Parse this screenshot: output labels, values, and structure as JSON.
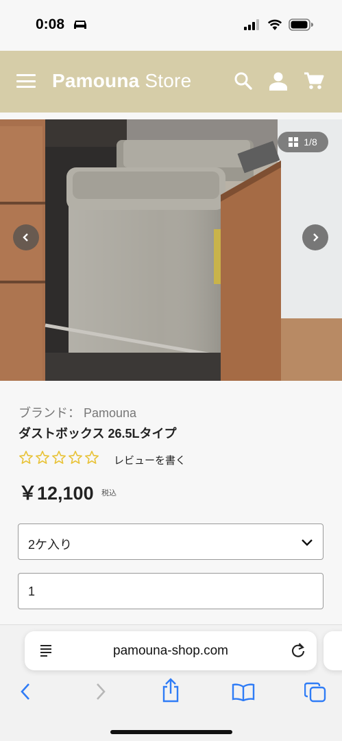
{
  "status": {
    "time": "0:08"
  },
  "header": {
    "brand_bold": "Pamouna",
    "brand_light": " Store"
  },
  "gallery": {
    "counter": "1/8"
  },
  "product": {
    "brand_line": "ブランド： Pamouna",
    "title": "ダストボックス 26.5Lタイプ",
    "review_link": "レビューを書く",
    "price": "￥12,100",
    "tax_label": "税込",
    "rating": 0,
    "variant_selected": "2ケ入り",
    "quantity": "1"
  },
  "browser": {
    "url": "pamouna-shop.com"
  },
  "colors": {
    "header_bg": "#d6cda8",
    "star": "#e8c33a",
    "safari_blue": "#2f7cf6"
  }
}
